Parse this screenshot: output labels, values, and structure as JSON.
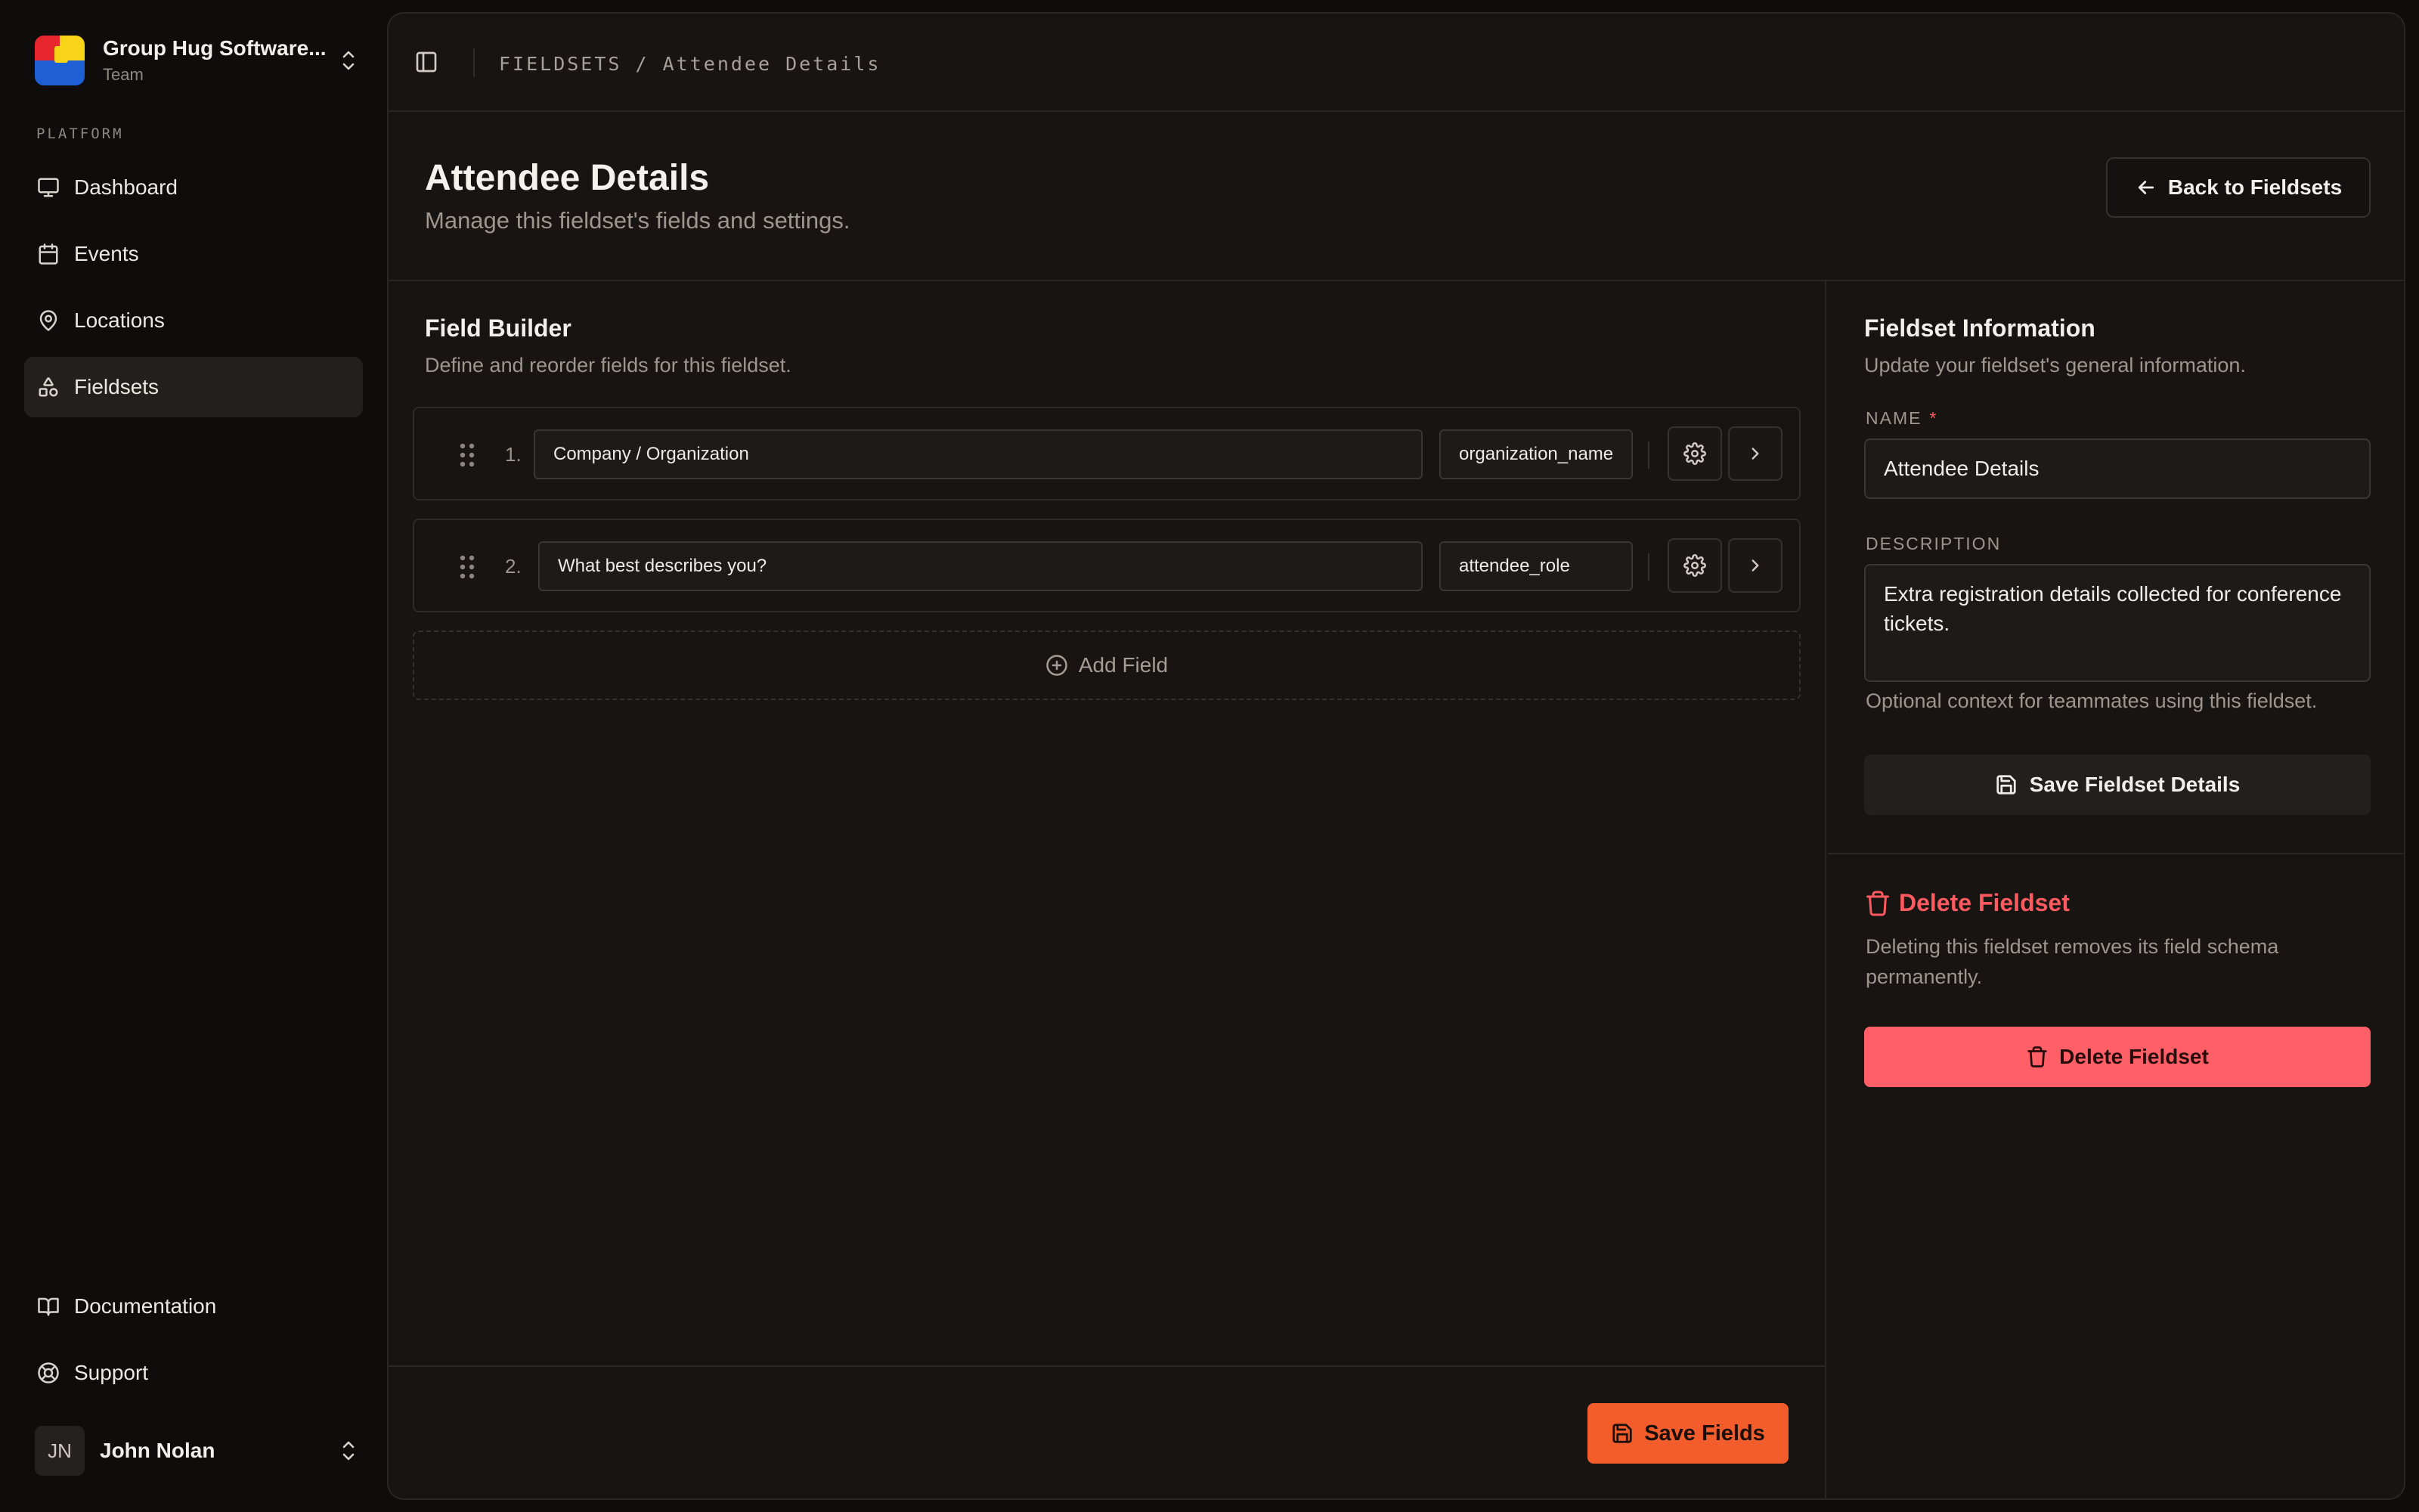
{
  "team": {
    "name": "Group Hug Software...",
    "plan": "Team"
  },
  "nav": {
    "section_label": "PLATFORM",
    "items": [
      {
        "label": "Dashboard",
        "icon": "monitor-icon"
      },
      {
        "label": "Events",
        "icon": "calendar-icon"
      },
      {
        "label": "Locations",
        "icon": "map-pin-icon"
      },
      {
        "label": "Fieldsets",
        "icon": "shapes-icon",
        "active": true
      }
    ],
    "bottom_items": [
      {
        "label": "Documentation",
        "icon": "book-icon"
      },
      {
        "label": "Support",
        "icon": "life-buoy-icon"
      }
    ]
  },
  "user": {
    "initials": "JN",
    "name": "John Nolan"
  },
  "breadcrumb": "FIELDSETS / Attendee Details",
  "header": {
    "title": "Attendee Details",
    "subtitle": "Manage this fieldset's fields and settings.",
    "back_label": "Back to Fieldsets"
  },
  "builder": {
    "title": "Field Builder",
    "subtitle": "Define and reorder fields for this fieldset.",
    "fields": [
      {
        "index": "1.",
        "label": "Company / Organization",
        "key": "organization_name"
      },
      {
        "index": "2.",
        "label": "What best describes you?",
        "key": "attendee_role"
      }
    ],
    "add_label": "Add Field",
    "save_label": "Save Fields"
  },
  "info": {
    "title": "Fieldset Information",
    "subtitle": "Update your fieldset's general information.",
    "name_label": "NAME",
    "name_required": "*",
    "name_value": "Attendee Details",
    "description_label": "DESCRIPTION",
    "description_value": "Extra registration details collected for conference tickets.",
    "description_help": "Optional context for teammates using this fieldset.",
    "save_label": "Save Fieldset Details"
  },
  "danger": {
    "title": "Delete Fieldset",
    "description": "Deleting this fieldset removes its field schema permanently.",
    "button_label": "Delete Fieldset"
  },
  "colors": {
    "accent": "#f35c2b",
    "danger": "#ff5f66",
    "background": "#0e0d0c",
    "panel": "#171412"
  }
}
